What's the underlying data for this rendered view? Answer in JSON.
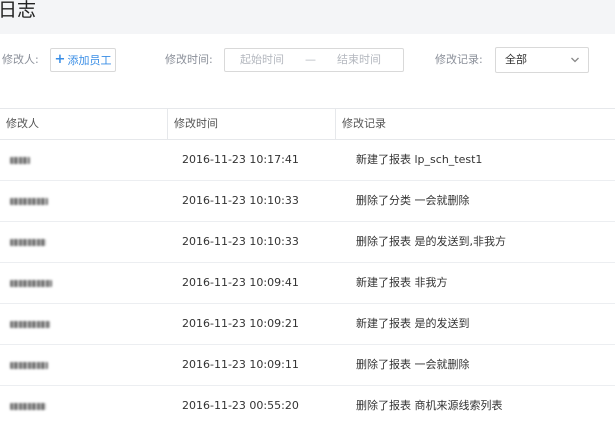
{
  "page": {
    "title": "日志"
  },
  "filters": {
    "modifier_label": "修改人:",
    "add_employee_label": "添加员工",
    "time_label": "修改时间:",
    "start_placeholder": "起始时间",
    "range_separator": "—",
    "end_placeholder": "结束时间",
    "record_label": "修改记录:",
    "record_selected": "全部"
  },
  "table": {
    "columns": [
      "修改人",
      "修改时间",
      "修改记录"
    ],
    "rows": [
      {
        "user": "",
        "time": "2016-11-23 10:17:41",
        "record": "新建了报表 lp_sch_test1"
      },
      {
        "user": "",
        "time": "2016-11-23 10:10:33",
        "record": "删除了分类 一会就删除"
      },
      {
        "user": "",
        "time": "2016-11-23 10:10:33",
        "record": "删除了报表 是的发送到,非我方"
      },
      {
        "user": "",
        "time": "2016-11-23 10:09:41",
        "record": "新建了报表 非我方"
      },
      {
        "user": "",
        "time": "2016-11-23 10:09:21",
        "record": "新建了报表 是的发送到"
      },
      {
        "user": "",
        "time": "2016-11-23 10:09:11",
        "record": "删除了报表 一会就删除"
      },
      {
        "user": "",
        "time": "2016-11-23 00:55:20",
        "record": "删除了报表 商机来源线索列表"
      }
    ]
  },
  "icons": {
    "add": "plus-icon",
    "dropdown": "chevron-down-icon"
  },
  "colors": {
    "accent": "#3a8ee6",
    "header_bg": "#f4f5f7",
    "border": "#d9d9d9"
  }
}
